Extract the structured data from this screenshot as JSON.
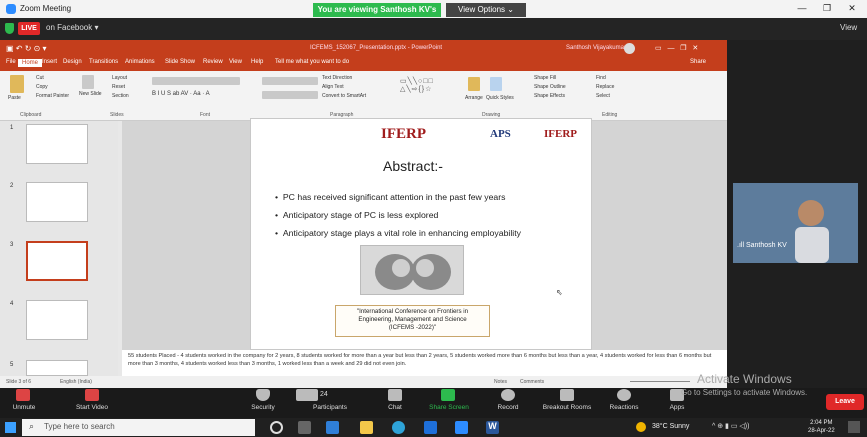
{
  "zoom": {
    "window_title": "Zoom Meeting",
    "viewing_banner": "You are viewing Santhosh KV's screen",
    "view_options": "View Options ⌄",
    "live_badge": "LIVE",
    "live_target": "on Facebook ▾",
    "view_label": "View"
  },
  "ppt": {
    "file_title": "ICFEMS_152067_Presentation.pptx - PowerPoint",
    "user": "Santhosh Vijayakumar",
    "tabs": [
      "File",
      "Home",
      "Insert",
      "Design",
      "Transitions",
      "Animations",
      "Slide Show",
      "Review",
      "View",
      "Help",
      "Tell me what you want to do"
    ],
    "share": "Share",
    "groups": [
      "Clipboard",
      "Slides",
      "Font",
      "Paragraph",
      "Drawing",
      "Editing"
    ],
    "ribbon_items": {
      "paste": "Paste",
      "cut": "Cut",
      "copy": "Copy",
      "format_painter": "Format Painter",
      "new_slide": "New Slide",
      "layout": "Layout",
      "reset": "Reset",
      "section": "Section",
      "text_direction": "Text Direction",
      "align_text": "Align Text",
      "smartart": "Convert to SmartArt",
      "arrange": "Arrange",
      "quick_styles": "Quick Styles",
      "shape_fill": "Shape Fill",
      "shape_outline": "Shape Outline",
      "shape_effects": "Shape Effects",
      "find": "Find",
      "replace": "Replace",
      "select": "Select"
    },
    "thumb_numbers": [
      "1",
      "2",
      "3",
      "4",
      "5"
    ],
    "status_left": "Slide 3 of 6",
    "status_lang": "English (India)",
    "notes_btn": "Notes",
    "comments_btn": "Comments"
  },
  "slide": {
    "logo_left": "IFERP",
    "logo_aps": "APS",
    "logo_right": "IFERP",
    "heading": "Abstract:-",
    "bullets": [
      "PC has received significant attention in the past few years",
      "Anticipatory stage of PC is less explored",
      "Anticipatory stage plays a vital role in enhancing employability"
    ],
    "conference": [
      "\"International Conference on Frontiers in",
      "Engineering, Management and Science",
      "(ICFEMS -2022)\""
    ]
  },
  "notes_text": "55 students Placed - 4 students worked in the company for 2 years, 8 students worked for more than a year but less than 2 years, 5 students worked more than 6 months but less than a year, 4 students worked for less than 6 months but more than 3 months, 4 students worked less than 3 months, 1 worked less than a week and 29 did not even join.",
  "video": {
    "name": "Santhosh KV"
  },
  "watermark": {
    "line1": "Activate Windows",
    "line2": "Go to Settings to activate Windows."
  },
  "controls": {
    "unmute": "Unmute",
    "start_video": "Start Video",
    "security": "Security",
    "participants": "Participants",
    "participant_count": "24",
    "chat": "Chat",
    "share_screen": "Share Screen",
    "record": "Record",
    "breakout": "Breakout Rooms",
    "reactions": "Reactions",
    "apps": "Apps",
    "leave": "Leave"
  },
  "taskbar": {
    "search": "Type here to search",
    "weather": "38°C  Sunny",
    "time": "2:04 PM",
    "date": "28-Apr-22"
  }
}
